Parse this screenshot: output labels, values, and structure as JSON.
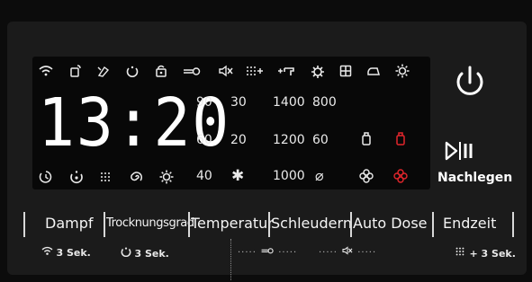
{
  "display": {
    "time": "13:20",
    "top_icons": [
      "wifi-icon",
      "remote-start-icon",
      "stain-icon",
      "delay-icon",
      "child-lock-icon",
      "door-lock-icon",
      "mute-icon",
      "dots-plus-icon",
      "water-plus-icon",
      "gear-icon",
      "grid-icon",
      "drying-icon",
      "sun-icon"
    ],
    "temps": [
      "90",
      "60",
      "40"
    ],
    "temps2": [
      "30",
      "20"
    ],
    "cold": "✱",
    "spins": [
      "1400",
      "1200",
      "1000"
    ],
    "spins2": [
      "800",
      "60"
    ],
    "no_spin": "⌀",
    "bottom_icons": [
      "end-time-icon",
      "remaining-icon",
      "dots-grid-icon",
      "spiral-icon",
      "settings-gear-icon"
    ]
  },
  "controls": {
    "nachlegen": "Nachlegen"
  },
  "tabs": [
    "Dampf",
    "Trocknungsgrad",
    "Temperatur",
    "Schleudern",
    "Auto Dose",
    "Endzeit"
  ],
  "hints": {
    "wifi": "3 Sek.",
    "delay": "3 Sek.",
    "plus": "+ 3 Sek."
  },
  "colors": {
    "accent_red": "#e3262c",
    "display_text": "#eaeaea"
  }
}
